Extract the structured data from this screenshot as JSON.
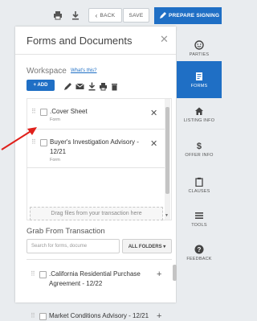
{
  "toolbar": {
    "back_label": "BACK",
    "save_label": "SAVE",
    "prepare_label": "PREPARE SIGNING",
    "icons": [
      "print-icon",
      "download-icon"
    ]
  },
  "panel": {
    "title": "Forms and Documents",
    "workspace_label": "Workspace",
    "whats_this": "What's this?",
    "add_label": "+ ADD",
    "toolbar_icons": [
      "pencil-icon",
      "mail-icon",
      "download-icon",
      "print-icon",
      "trash-icon"
    ],
    "documents": [
      {
        "name": ".Cover Sheet",
        "type": "Form"
      },
      {
        "name": "Buyer's Investigation Advisory - 12/21",
        "type": "Form"
      }
    ],
    "dropzone_text": "Drag files from your transaction here",
    "grab_label": "Grab From Transaction",
    "search_placeholder": "Search for forms, docume",
    "folders_label": "ALL FOLDERS ▾",
    "transaction_items": [
      {
        "name": ".California Residential Purchase Agreement - 12/22"
      },
      {
        "name": "Market Conditions Advisory - 12/21"
      }
    ]
  },
  "sidebar": {
    "items": [
      {
        "label": "PARTIES",
        "icon": "smiley-icon"
      },
      {
        "label": "FORMS",
        "icon": "forms-icon",
        "active": true
      },
      {
        "label": "LISTING INFO",
        "icon": "home-icon"
      },
      {
        "label": "OFFER INFO",
        "icon": "dollar-icon"
      },
      {
        "label": "CLAUSES",
        "icon": "clipboard-icon"
      },
      {
        "label": "TOOLS",
        "icon": "list-icon"
      },
      {
        "label": "FEEDBACK",
        "icon": "question-icon"
      }
    ]
  },
  "colors": {
    "accent": "#1f6fc5",
    "annotation_arrow": "#e0201b"
  }
}
